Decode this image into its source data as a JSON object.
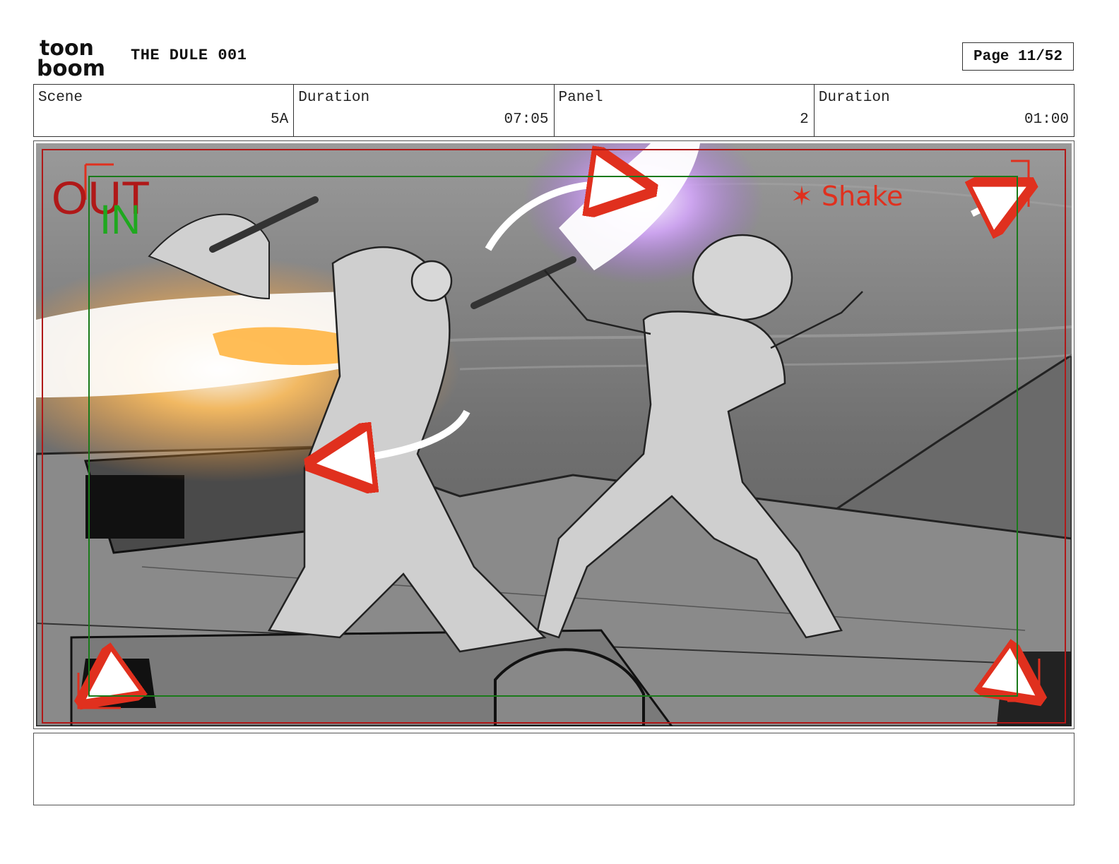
{
  "header": {
    "logo": {
      "line1": "toon",
      "line2": "boom"
    },
    "title": "THE DULE 001",
    "page": "Page 11/52"
  },
  "info": {
    "scene_label": "Scene",
    "scene_value": "5A",
    "duration_label": "Duration",
    "duration_value": "07:05",
    "panel_label": "Panel",
    "panel_value": "2",
    "panel_duration_label": "Duration",
    "panel_duration_value": "01:00"
  },
  "panel": {
    "out_label": "OUT",
    "in_label": "IN",
    "note": "✶ Shake",
    "colors": {
      "out_frame": "#b01818",
      "in_frame": "#1a7a1a",
      "annotation": "#e0301e",
      "glow_orange": "#ffb040",
      "glow_purple": "#b070e0"
    }
  },
  "notes": {
    "text": ""
  }
}
